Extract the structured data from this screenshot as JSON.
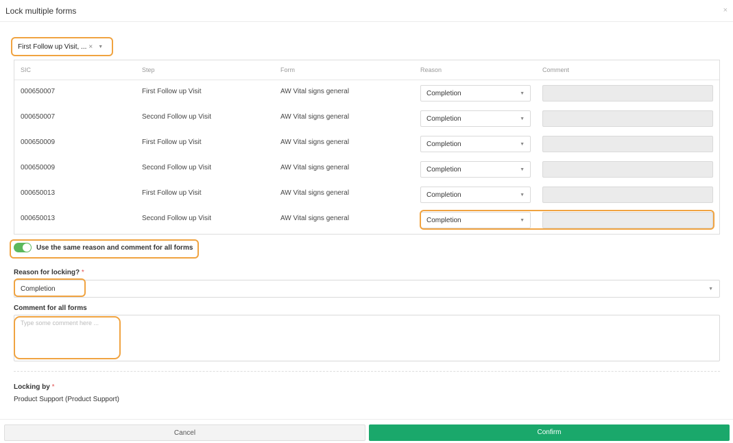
{
  "dialog": {
    "title": "Lock multiple forms",
    "close_glyph": "×"
  },
  "filter": {
    "value": "First Follow up Visit, ...",
    "clear_glyph": "×",
    "caret": "▼"
  },
  "table": {
    "headers": [
      "SIC",
      "Step",
      "Form",
      "Reason",
      "Comment"
    ],
    "rows": [
      {
        "sic": "000650007",
        "step": "First Follow up Visit",
        "form": "AW Vital signs general",
        "reason": "Completion",
        "comment": ""
      },
      {
        "sic": "000650007",
        "step": "Second Follow up Visit",
        "form": "AW Vital signs general",
        "reason": "Completion",
        "comment": ""
      },
      {
        "sic": "000650009",
        "step": "First Follow up Visit",
        "form": "AW Vital signs general",
        "reason": "Completion",
        "comment": ""
      },
      {
        "sic": "000650009",
        "step": "Second Follow up Visit",
        "form": "AW Vital signs general",
        "reason": "Completion",
        "comment": ""
      },
      {
        "sic": "000650013",
        "step": "First Follow up Visit",
        "form": "AW Vital signs general",
        "reason": "Completion",
        "comment": ""
      },
      {
        "sic": "000650013",
        "step": "Second Follow up Visit",
        "form": "AW Vital signs general",
        "reason": "Completion",
        "comment": ""
      }
    ]
  },
  "same_reason_toggle": {
    "label": "Use the same reason and comment for all forms",
    "on": true
  },
  "reason_field": {
    "label": "Reason for locking?",
    "required_mark": "*",
    "value": "Completion"
  },
  "comment_field": {
    "label": "Comment for all forms",
    "placeholder": "Type some comment here ...",
    "value": ""
  },
  "locking_by": {
    "label": "Locking by",
    "required_mark": "*",
    "value": "Product Support (Product Support)"
  },
  "buttons": {
    "cancel": "Cancel",
    "confirm": "Confirm"
  },
  "colors": {
    "accent": "#1aa86b",
    "toggle_on": "#5cb85c",
    "highlight": "#f0a340",
    "required": "#e05050"
  },
  "icons": {
    "select_caret": "chevron-down-icon",
    "clear": "close-icon"
  }
}
